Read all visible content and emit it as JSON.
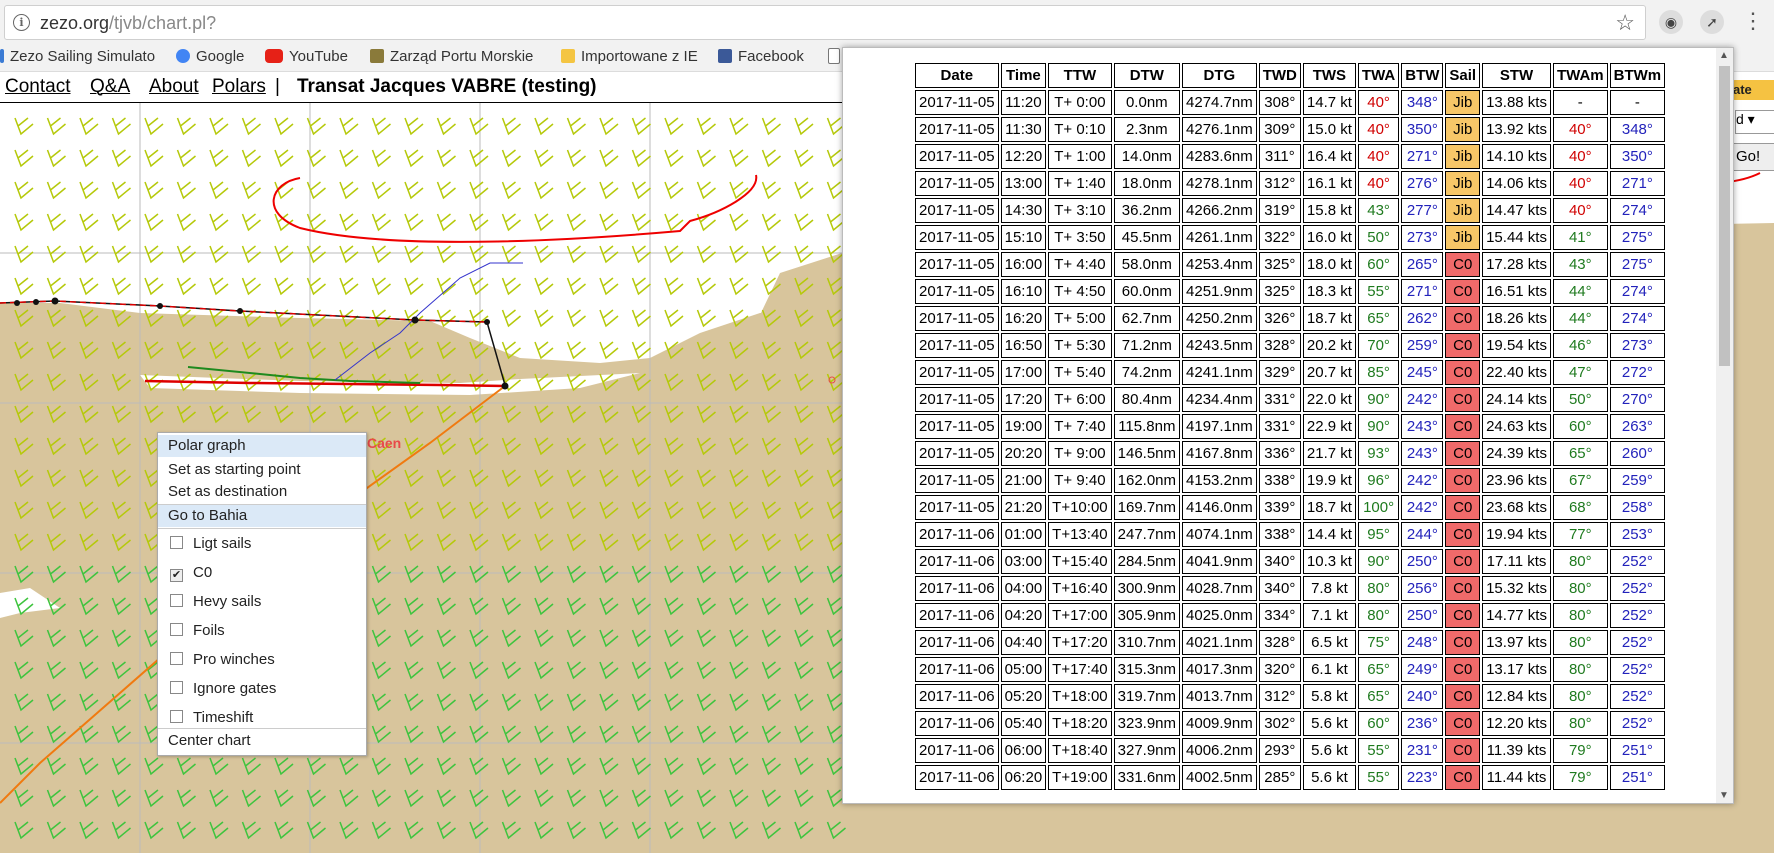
{
  "browser": {
    "url_main": "zezo.org",
    "url_path": "/tjvb/chart.pl?",
    "info_icon": "info-icon",
    "star_icon": "star-icon"
  },
  "bookmarks": [
    {
      "label": "Zezo Sailing Simulato",
      "color": "#3b7bd4"
    },
    {
      "label": "Google",
      "color": "#4285f4"
    },
    {
      "label": "YouTube",
      "color": "#e62117"
    },
    {
      "label": "Zarząd Portu Morskie",
      "color": "#8a7a3a"
    },
    {
      "label": "Importowane z IE",
      "color": "#f4c542"
    },
    {
      "label": "Facebook",
      "color": "#3b5998"
    }
  ],
  "nav": {
    "contact": "Contact",
    "qa": "Q&A",
    "about": "About",
    "polars": "Polars",
    "separator": "|",
    "title": "Transat Jacques VABRE (testing)"
  },
  "map": {
    "city_label": "Caen",
    "edge_badge": "ate",
    "edge_select": "d",
    "edge_go": "Go!"
  },
  "context_menu": {
    "polar_graph": "Polar graph",
    "set_start": "Set as starting point",
    "set_dest": "Set as destination",
    "go_to": "Go to Bahia",
    "options": [
      {
        "label": "Ligt sails",
        "checked": false
      },
      {
        "label": "C0",
        "checked": true
      },
      {
        "label": "Hevy sails",
        "checked": false
      },
      {
        "label": "Foils",
        "checked": false
      },
      {
        "label": "Pro winches",
        "checked": false
      },
      {
        "label": "Ignore gates",
        "checked": false
      },
      {
        "label": "Timeshift",
        "checked": false
      }
    ],
    "center_chart": "Center chart"
  },
  "table": {
    "headers": [
      "Date",
      "Time",
      "TTW",
      "DTW",
      "DTG",
      "TWD",
      "TWS",
      "TWA",
      "BTW",
      "Sail",
      "STW",
      "TWAm",
      "BTWm"
    ],
    "rows": [
      [
        "2017-11-05",
        "11:20",
        "T+ 0:00",
        "0.0nm",
        "4274.7nm",
        "308°",
        "14.7 kt",
        "40°",
        "348°",
        "Jib",
        "13.88 kts",
        "-",
        "-"
      ],
      [
        "2017-11-05",
        "11:30",
        "T+ 0:10",
        "2.3nm",
        "4276.1nm",
        "309°",
        "15.0 kt",
        "40°",
        "350°",
        "Jib",
        "13.92 kts",
        "40°",
        "348°"
      ],
      [
        "2017-11-05",
        "12:20",
        "T+ 1:00",
        "14.0nm",
        "4283.6nm",
        "311°",
        "16.4 kt",
        "40°",
        "271°",
        "Jib",
        "14.10 kts",
        "40°",
        "350°"
      ],
      [
        "2017-11-05",
        "13:00",
        "T+ 1:40",
        "18.0nm",
        "4278.1nm",
        "312°",
        "16.1 kt",
        "40°",
        "276°",
        "Jib",
        "14.06 kts",
        "40°",
        "271°"
      ],
      [
        "2017-11-05",
        "14:30",
        "T+ 3:10",
        "36.2nm",
        "4266.2nm",
        "319°",
        "15.8 kt",
        "43°",
        "277°",
        "Jib",
        "14.47 kts",
        "40°",
        "274°"
      ],
      [
        "2017-11-05",
        "15:10",
        "T+ 3:50",
        "45.5nm",
        "4261.1nm",
        "322°",
        "16.0 kt",
        "50°",
        "273°",
        "Jib",
        "15.44 kts",
        "41°",
        "275°"
      ],
      [
        "2017-11-05",
        "16:00",
        "T+ 4:40",
        "58.0nm",
        "4253.4nm",
        "325°",
        "18.0 kt",
        "60°",
        "265°",
        "C0",
        "17.28 kts",
        "43°",
        "275°"
      ],
      [
        "2017-11-05",
        "16:10",
        "T+ 4:50",
        "60.0nm",
        "4251.9nm",
        "325°",
        "18.3 kt",
        "55°",
        "271°",
        "C0",
        "16.51 kts",
        "44°",
        "274°"
      ],
      [
        "2017-11-05",
        "16:20",
        "T+ 5:00",
        "62.7nm",
        "4250.2nm",
        "326°",
        "18.7 kt",
        "65°",
        "262°",
        "C0",
        "18.26 kts",
        "44°",
        "274°"
      ],
      [
        "2017-11-05",
        "16:50",
        "T+ 5:30",
        "71.2nm",
        "4243.5nm",
        "328°",
        "20.2 kt",
        "70°",
        "259°",
        "C0",
        "19.54 kts",
        "46°",
        "273°"
      ],
      [
        "2017-11-05",
        "17:00",
        "T+ 5:40",
        "74.2nm",
        "4241.1nm",
        "329°",
        "20.7 kt",
        "85°",
        "245°",
        "C0",
        "22.40 kts",
        "47°",
        "272°"
      ],
      [
        "2017-11-05",
        "17:20",
        "T+ 6:00",
        "80.4nm",
        "4234.4nm",
        "331°",
        "22.0 kt",
        "90°",
        "242°",
        "C0",
        "24.14 kts",
        "50°",
        "270°"
      ],
      [
        "2017-11-05",
        "19:00",
        "T+ 7:40",
        "115.8nm",
        "4197.1nm",
        "331°",
        "22.9 kt",
        "90°",
        "243°",
        "C0",
        "24.63 kts",
        "60°",
        "263°"
      ],
      [
        "2017-11-05",
        "20:20",
        "T+ 9:00",
        "146.5nm",
        "4167.8nm",
        "336°",
        "21.7 kt",
        "93°",
        "243°",
        "C0",
        "24.39 kts",
        "65°",
        "260°"
      ],
      [
        "2017-11-05",
        "21:00",
        "T+ 9:40",
        "162.0nm",
        "4153.2nm",
        "338°",
        "19.9 kt",
        "96°",
        "242°",
        "C0",
        "23.96 kts",
        "67°",
        "259°"
      ],
      [
        "2017-11-05",
        "21:20",
        "T+10:00",
        "169.7nm",
        "4146.0nm",
        "339°",
        "18.7 kt",
        "100°",
        "242°",
        "C0",
        "23.68 kts",
        "68°",
        "258°"
      ],
      [
        "2017-11-06",
        "01:00",
        "T+13:40",
        "247.7nm",
        "4074.1nm",
        "338°",
        "14.4 kt",
        "95°",
        "244°",
        "C0",
        "19.94 kts",
        "77°",
        "253°"
      ],
      [
        "2017-11-06",
        "03:00",
        "T+15:40",
        "284.5nm",
        "4041.9nm",
        "340°",
        "10.3 kt",
        "90°",
        "250°",
        "C0",
        "17.11 kts",
        "80°",
        "252°"
      ],
      [
        "2017-11-06",
        "04:00",
        "T+16:40",
        "300.9nm",
        "4028.7nm",
        "340°",
        "7.8 kt",
        "80°",
        "256°",
        "C0",
        "15.32 kts",
        "80°",
        "252°"
      ],
      [
        "2017-11-06",
        "04:20",
        "T+17:00",
        "305.9nm",
        "4025.0nm",
        "334°",
        "7.1 kt",
        "80°",
        "250°",
        "C0",
        "14.77 kts",
        "80°",
        "252°"
      ],
      [
        "2017-11-06",
        "04:40",
        "T+17:20",
        "310.7nm",
        "4021.1nm",
        "328°",
        "6.5 kt",
        "75°",
        "248°",
        "C0",
        "13.97 kts",
        "80°",
        "252°"
      ],
      [
        "2017-11-06",
        "05:00",
        "T+17:40",
        "315.3nm",
        "4017.3nm",
        "320°",
        "6.1 kt",
        "65°",
        "249°",
        "C0",
        "13.17 kts",
        "80°",
        "252°"
      ],
      [
        "2017-11-06",
        "05:20",
        "T+18:00",
        "319.7nm",
        "4013.7nm",
        "312°",
        "5.8 kt",
        "65°",
        "240°",
        "C0",
        "12.84 kts",
        "80°",
        "252°"
      ],
      [
        "2017-11-06",
        "05:40",
        "T+18:20",
        "323.9nm",
        "4009.9nm",
        "302°",
        "5.6 kt",
        "60°",
        "236°",
        "C0",
        "12.20 kts",
        "80°",
        "252°"
      ],
      [
        "2017-11-06",
        "06:00",
        "T+18:40",
        "327.9nm",
        "4006.2nm",
        "293°",
        "5.6 kt",
        "55°",
        "231°",
        "C0",
        "11.39 kts",
        "79°",
        "251°"
      ],
      [
        "2017-11-06",
        "06:20",
        "T+19:00",
        "331.6nm",
        "4002.5nm",
        "285°",
        "5.6 kt",
        "55°",
        "223°",
        "C0",
        "11.44 kts",
        "79°",
        "251°"
      ]
    ]
  }
}
